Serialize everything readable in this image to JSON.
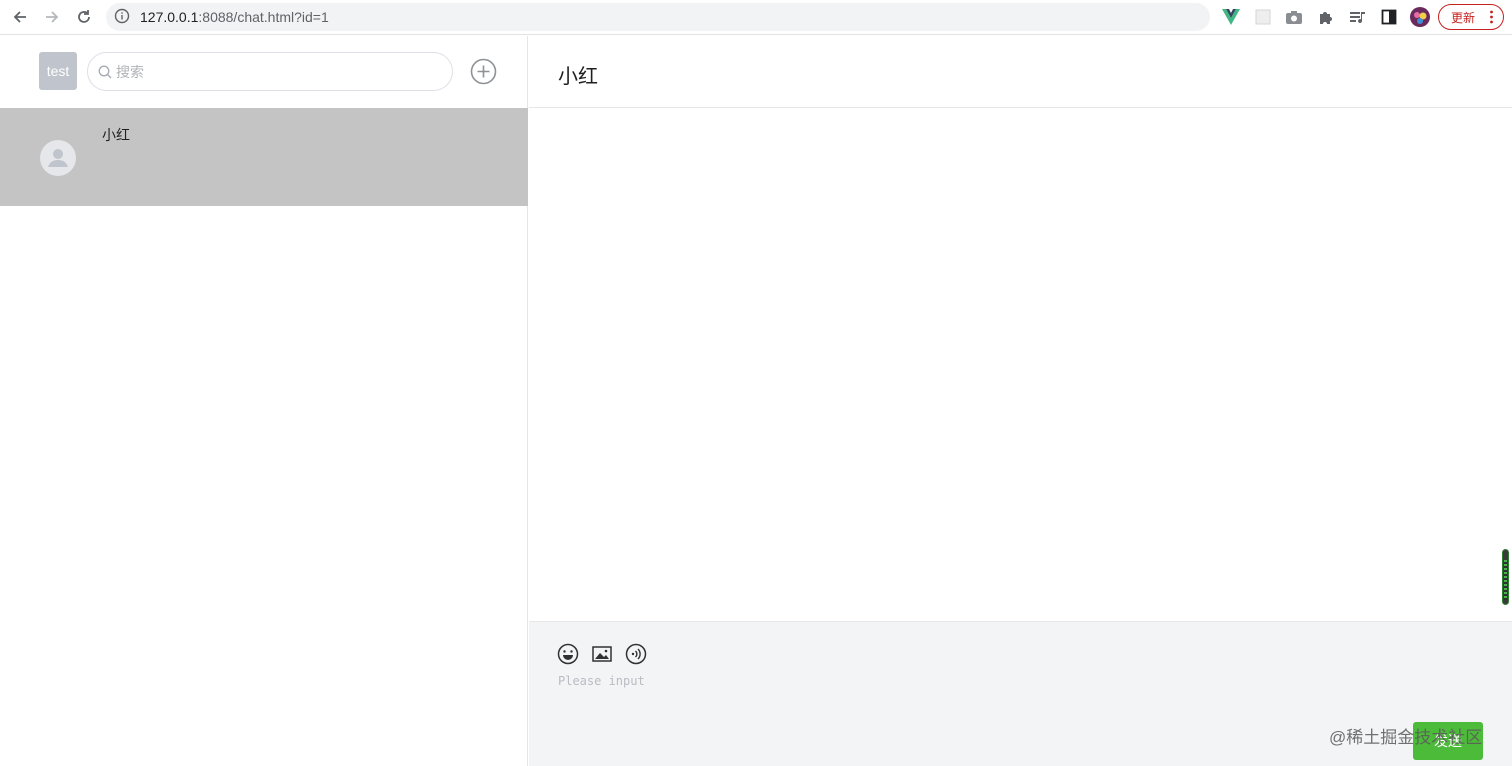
{
  "browser": {
    "url_host": "127.0.0.1",
    "url_rest": ":8088/chat.html?id=1",
    "update_label": "更新"
  },
  "sidebar": {
    "user_avatar_text": "test",
    "search_placeholder": "搜索",
    "contacts": [
      {
        "name": "小红"
      }
    ]
  },
  "chat": {
    "title": "小红",
    "input_placeholder": "Please input",
    "send_label": "发送",
    "watermark": "@稀土掘金技术社区"
  },
  "colors": {
    "selected_contact_bg": "#c4c4c4",
    "send_button": "#4cbb3a",
    "composer_bg": "#f3f4f6"
  }
}
